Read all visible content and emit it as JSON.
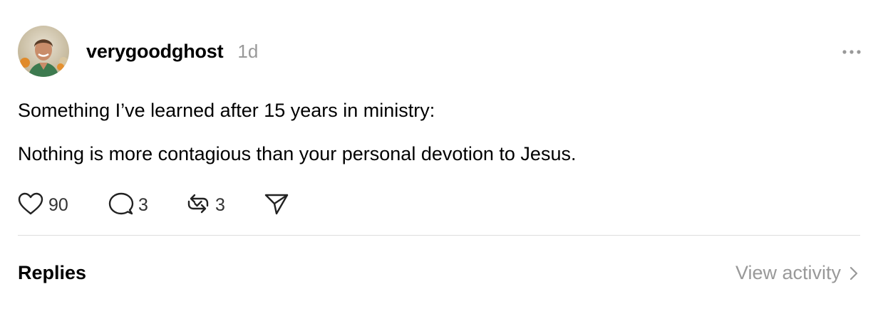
{
  "post": {
    "username": "verygoodghost",
    "timestamp": "1d",
    "text_lines": [
      "Something I’ve learned after 15 years in ministry:",
      "Nothing is more contagious than your personal devotion to Jesus."
    ],
    "actions": {
      "likes": "90",
      "replies": "3",
      "reposts": "3"
    },
    "icons": {
      "more": "more-horizontal-icon",
      "like": "heart-icon",
      "reply": "speech-bubble-icon",
      "repost": "repost-icon",
      "share": "send-icon",
      "chevron": "chevron-right-icon"
    }
  },
  "replies_section": {
    "label": "Replies",
    "view_activity_label": "View activity"
  },
  "colors": {
    "text": "#000000",
    "muted": "#999999",
    "divider": "#dddddd"
  }
}
